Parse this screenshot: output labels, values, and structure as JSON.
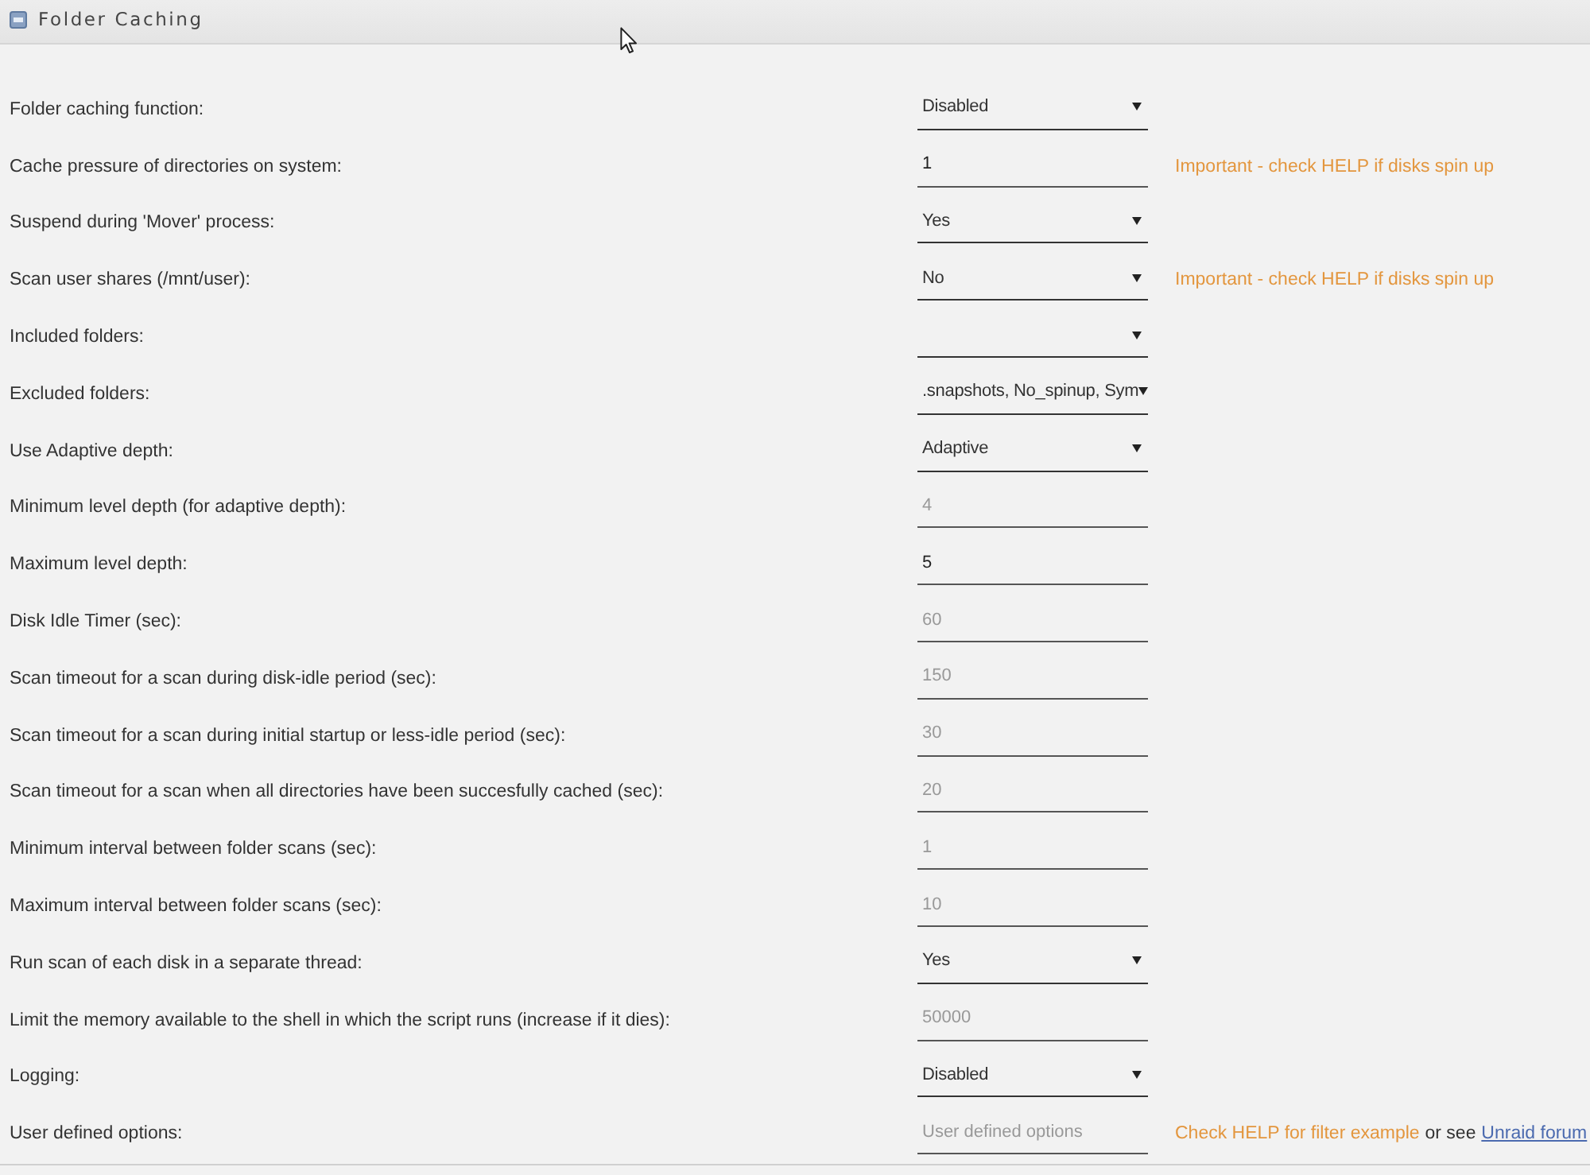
{
  "header": {
    "title": "Folder Caching"
  },
  "settings": [
    {
      "label": "Folder caching function:",
      "kind": "select",
      "value": "Disabled"
    },
    {
      "label": "Cache pressure of directories on system:",
      "kind": "input",
      "value": "1",
      "note": [
        {
          "kind": "warning",
          "text": "Important - check HELP if disks spin up"
        }
      ]
    },
    {
      "label": "Suspend during 'Mover' process:",
      "kind": "select",
      "value": "Yes"
    },
    {
      "label": "Scan user shares (/mnt/user):",
      "kind": "select",
      "value": "No",
      "note": [
        {
          "kind": "warning",
          "text": "Important - check HELP if disks spin up"
        }
      ]
    },
    {
      "label": "Included folders:",
      "kind": "select"
    },
    {
      "label": "Excluded folders:",
      "kind": "select",
      "value": ".snapshots, No_spinup, Sym"
    },
    {
      "label": "Use Adaptive depth:",
      "kind": "select",
      "value": "Adaptive"
    },
    {
      "label": "Minimum level depth (for adaptive depth):",
      "kind": "input",
      "placeholder": "4"
    },
    {
      "label": "Maximum level depth:",
      "kind": "input",
      "value": "5"
    },
    {
      "label": "Disk Idle Timer (sec):",
      "kind": "input",
      "placeholder": "60"
    },
    {
      "label": "Scan timeout for a scan during disk-idle period (sec):",
      "kind": "input",
      "placeholder": "150"
    },
    {
      "label": "Scan timeout for a scan during initial startup or less-idle period (sec):",
      "kind": "input",
      "placeholder": "30"
    },
    {
      "label": "Scan timeout for a scan when all directories have been succesfully cached (sec):",
      "kind": "input",
      "placeholder": "20"
    },
    {
      "label": "Minimum interval between folder scans (sec):",
      "kind": "input",
      "placeholder": "1"
    },
    {
      "label": "Maximum interval between folder scans (sec):",
      "kind": "input",
      "placeholder": "10"
    },
    {
      "label": "Run scan of each disk in a separate thread:",
      "kind": "select",
      "value": "Yes"
    },
    {
      "label": "Limit the memory available to the shell in which the script runs (increase if it dies):",
      "kind": "input",
      "placeholder": "50000"
    },
    {
      "label": "Logging:",
      "kind": "select",
      "value": "Disabled"
    },
    {
      "label": "User defined options:",
      "kind": "input",
      "placeholder": "User defined options",
      "note": [
        {
          "kind": "warning",
          "text": "Check HELP for filter example"
        },
        {
          "kind": "text",
          "text": "or see"
        },
        {
          "kind": "link",
          "text": "Unraid forum"
        }
      ]
    }
  ]
}
